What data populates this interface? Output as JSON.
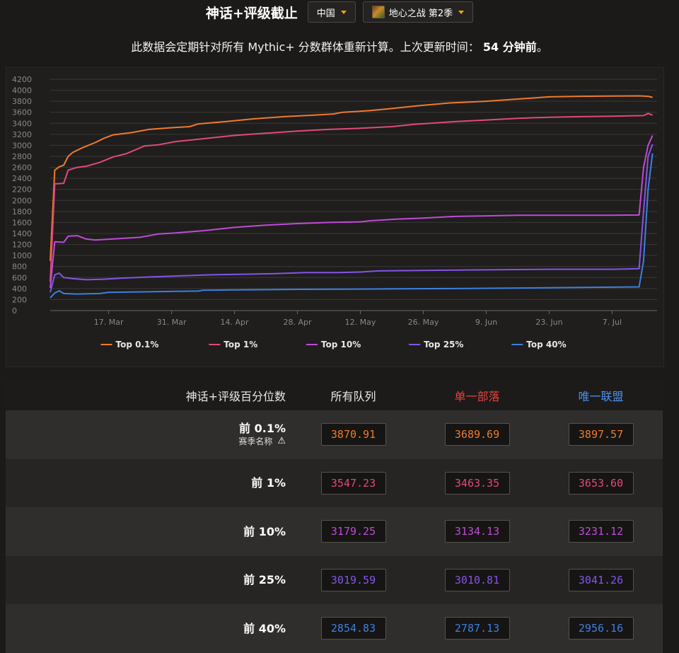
{
  "header": {
    "title": "神话+评级截止",
    "region": {
      "label": "中国"
    },
    "season": {
      "label": "地心之战 第2季",
      "icon": "season-icon"
    }
  },
  "subtitle": {
    "text": "此数据会定期针对所有 Mythic+ 分数群体重新计算。上次更新时间：",
    "updated": "54 分钟前",
    "suffix": "。"
  },
  "colors": {
    "top01": "#f07a2a",
    "top1": "#e04a78",
    "top10": "#c04ad8",
    "top25": "#8454e6",
    "top40": "#3d7fe0",
    "horde": "#e8403a",
    "alliance": "#4d8fe8"
  },
  "chart_data": {
    "type": "line",
    "ylim": [
      0,
      4200
    ],
    "yticks": [
      0,
      200,
      400,
      600,
      800,
      1000,
      1200,
      1400,
      1600,
      1800,
      2000,
      2200,
      2400,
      2600,
      2800,
      3000,
      3200,
      3400,
      3600,
      3800,
      4000,
      4200
    ],
    "x_start": "2025-03-04",
    "x_end": "2025-07-17",
    "x_ticks": [
      {
        "date": "2025-03-17",
        "label": "17. Mar"
      },
      {
        "date": "2025-03-31",
        "label": "31. Mar"
      },
      {
        "date": "2025-04-14",
        "label": "14. Apr"
      },
      {
        "date": "2025-04-28",
        "label": "28. Apr"
      },
      {
        "date": "2025-05-12",
        "label": "12. May"
      },
      {
        "date": "2025-05-26",
        "label": "26. May"
      },
      {
        "date": "2025-06-09",
        "label": "9. Jun"
      },
      {
        "date": "2025-06-23",
        "label": "23. Jun"
      },
      {
        "date": "2025-07-07",
        "label": "7. Jul"
      }
    ],
    "legend_position": "bottom",
    "series": [
      {
        "name": "Top 0.1%",
        "color": "#f07a2a",
        "points": [
          [
            "2025-03-04",
            900
          ],
          [
            "2025-03-05",
            2550
          ],
          [
            "2025-03-06",
            2610
          ],
          [
            "2025-03-07",
            2640
          ],
          [
            "2025-03-08",
            2800
          ],
          [
            "2025-03-09",
            2870
          ],
          [
            "2025-03-11",
            2950
          ],
          [
            "2025-03-14",
            3050
          ],
          [
            "2025-03-16",
            3130
          ],
          [
            "2025-03-18",
            3190
          ],
          [
            "2025-03-22",
            3230
          ],
          [
            "2025-03-26",
            3290
          ],
          [
            "2025-03-31",
            3320
          ],
          [
            "2025-04-04",
            3340
          ],
          [
            "2025-04-06",
            3390
          ],
          [
            "2025-04-12",
            3430
          ],
          [
            "2025-04-18",
            3480
          ],
          [
            "2025-04-25",
            3520
          ],
          [
            "2025-05-02",
            3550
          ],
          [
            "2025-05-06",
            3570
          ],
          [
            "2025-05-08",
            3600
          ],
          [
            "2025-05-14",
            3630
          ],
          [
            "2025-05-18",
            3660
          ],
          [
            "2025-05-25",
            3720
          ],
          [
            "2025-06-01",
            3770
          ],
          [
            "2025-06-09",
            3800
          ],
          [
            "2025-06-16",
            3840
          ],
          [
            "2025-06-23",
            3880
          ],
          [
            "2025-06-30",
            3890
          ],
          [
            "2025-07-07",
            3895
          ],
          [
            "2025-07-13",
            3898
          ],
          [
            "2025-07-15",
            3890
          ],
          [
            "2025-07-16",
            3871
          ]
        ]
      },
      {
        "name": "Top 1%",
        "color": "#e04a78",
        "points": [
          [
            "2025-03-04",
            520
          ],
          [
            "2025-03-05",
            2300
          ],
          [
            "2025-03-07",
            2310
          ],
          [
            "2025-03-08",
            2550
          ],
          [
            "2025-03-10",
            2600
          ],
          [
            "2025-03-12",
            2620
          ],
          [
            "2025-03-15",
            2690
          ],
          [
            "2025-03-18",
            2790
          ],
          [
            "2025-03-21",
            2850
          ],
          [
            "2025-03-25",
            2990
          ],
          [
            "2025-03-28",
            3010
          ],
          [
            "2025-04-01",
            3070
          ],
          [
            "2025-04-07",
            3120
          ],
          [
            "2025-04-14",
            3180
          ],
          [
            "2025-04-21",
            3220
          ],
          [
            "2025-04-28",
            3260
          ],
          [
            "2025-05-05",
            3290
          ],
          [
            "2025-05-12",
            3310
          ],
          [
            "2025-05-19",
            3340
          ],
          [
            "2025-05-24",
            3380
          ],
          [
            "2025-06-02",
            3430
          ],
          [
            "2025-06-09",
            3460
          ],
          [
            "2025-06-16",
            3490
          ],
          [
            "2025-06-23",
            3510
          ],
          [
            "2025-06-30",
            3520
          ],
          [
            "2025-07-07",
            3530
          ],
          [
            "2025-07-14",
            3540
          ],
          [
            "2025-07-15",
            3580
          ],
          [
            "2025-07-16",
            3547
          ]
        ]
      },
      {
        "name": "Top 10%",
        "color": "#c04ad8",
        "points": [
          [
            "2025-03-04",
            410
          ],
          [
            "2025-03-05",
            1250
          ],
          [
            "2025-03-07",
            1240
          ],
          [
            "2025-03-08",
            1350
          ],
          [
            "2025-03-10",
            1360
          ],
          [
            "2025-03-12",
            1300
          ],
          [
            "2025-03-14",
            1280
          ],
          [
            "2025-03-18",
            1300
          ],
          [
            "2025-03-24",
            1330
          ],
          [
            "2025-03-28",
            1390
          ],
          [
            "2025-04-01",
            1410
          ],
          [
            "2025-04-07",
            1450
          ],
          [
            "2025-04-14",
            1510
          ],
          [
            "2025-04-21",
            1550
          ],
          [
            "2025-04-28",
            1580
          ],
          [
            "2025-05-05",
            1600
          ],
          [
            "2025-05-12",
            1610
          ],
          [
            "2025-05-14",
            1630
          ],
          [
            "2025-05-20",
            1660
          ],
          [
            "2025-05-26",
            1680
          ],
          [
            "2025-06-02",
            1710
          ],
          [
            "2025-06-09",
            1720
          ],
          [
            "2025-06-16",
            1730
          ],
          [
            "2025-06-23",
            1730
          ],
          [
            "2025-07-07",
            1730
          ],
          [
            "2025-07-13",
            1735
          ],
          [
            "2025-07-14",
            2600
          ],
          [
            "2025-07-15",
            3000
          ],
          [
            "2025-07-16",
            3179
          ]
        ]
      },
      {
        "name": "Top 25%",
        "color": "#8454e6",
        "points": [
          [
            "2025-03-04",
            330
          ],
          [
            "2025-03-05",
            650
          ],
          [
            "2025-03-06",
            680
          ],
          [
            "2025-03-07",
            600
          ],
          [
            "2025-03-09",
            580
          ],
          [
            "2025-03-12",
            560
          ],
          [
            "2025-03-16",
            570
          ],
          [
            "2025-03-20",
            590
          ],
          [
            "2025-03-26",
            610
          ],
          [
            "2025-04-02",
            630
          ],
          [
            "2025-04-09",
            650
          ],
          [
            "2025-04-16",
            660
          ],
          [
            "2025-04-23",
            670
          ],
          [
            "2025-04-30",
            690
          ],
          [
            "2025-05-07",
            690
          ],
          [
            "2025-05-12",
            700
          ],
          [
            "2025-05-16",
            720
          ],
          [
            "2025-05-26",
            730
          ],
          [
            "2025-06-09",
            740
          ],
          [
            "2025-06-23",
            750
          ],
          [
            "2025-07-07",
            750
          ],
          [
            "2025-07-13",
            760
          ],
          [
            "2025-07-14",
            1800
          ],
          [
            "2025-07-15",
            2800
          ],
          [
            "2025-07-16",
            3020
          ]
        ]
      },
      {
        "name": "Top 40%",
        "color": "#3d7fe0",
        "points": [
          [
            "2025-03-04",
            230
          ],
          [
            "2025-03-05",
            320
          ],
          [
            "2025-03-06",
            360
          ],
          [
            "2025-03-07",
            310
          ],
          [
            "2025-03-10",
            300
          ],
          [
            "2025-03-15",
            310
          ],
          [
            "2025-03-17",
            330
          ],
          [
            "2025-03-25",
            340
          ],
          [
            "2025-04-01",
            350
          ],
          [
            "2025-04-06",
            355
          ],
          [
            "2025-04-07",
            370
          ],
          [
            "2025-04-14",
            375
          ],
          [
            "2025-04-28",
            385
          ],
          [
            "2025-05-12",
            390
          ],
          [
            "2025-05-20",
            395
          ],
          [
            "2025-06-02",
            400
          ],
          [
            "2025-06-16",
            410
          ],
          [
            "2025-06-30",
            420
          ],
          [
            "2025-07-07",
            425
          ],
          [
            "2025-07-13",
            430
          ],
          [
            "2025-07-14",
            900
          ],
          [
            "2025-07-15",
            2200
          ],
          [
            "2025-07-16",
            2855
          ]
        ]
      }
    ]
  },
  "table": {
    "headers": {
      "label": "神话+评级百分位数",
      "all": "所有队列",
      "horde": "单一部落",
      "alliance": "唯一联盟"
    },
    "rows": [
      {
        "label": "前 0.1%",
        "note": "赛季名称",
        "note_icon": "warning-icon",
        "color": "#f07a2a",
        "all": "3870.91",
        "horde": "3689.69",
        "alliance": "3897.57"
      },
      {
        "label": "前 1%",
        "color": "#e04a78",
        "all": "3547.23",
        "horde": "3463.35",
        "alliance": "3653.60"
      },
      {
        "label": "前 10%",
        "color": "#c04ad8",
        "all": "3179.25",
        "horde": "3134.13",
        "alliance": "3231.12"
      },
      {
        "label": "前 25%",
        "color": "#8454e6",
        "all": "3019.59",
        "horde": "3010.81",
        "alliance": "3041.26"
      },
      {
        "label": "前 40%",
        "color": "#3d7fe0",
        "all": "2854.83",
        "horde": "2787.13",
        "alliance": "2956.16"
      }
    ]
  }
}
